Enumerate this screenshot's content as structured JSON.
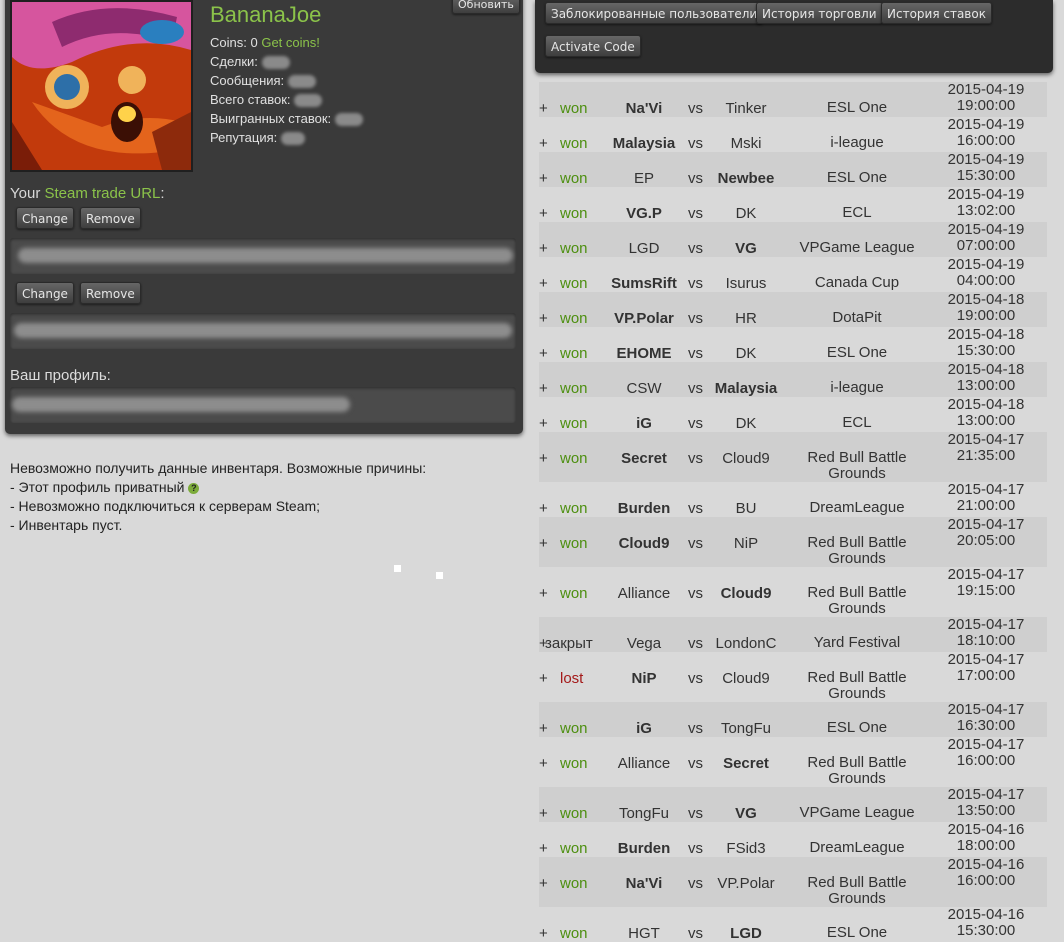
{
  "profile": {
    "username": "BananaJoe",
    "refresh_button": "Обновить",
    "stats": {
      "coins_label": "Coins: 0",
      "get_coins": "Get coins!",
      "deals": "Сделки:",
      "messages": "Сообщения:",
      "total_bets": "Всего ставок:",
      "won_bets": "Выигранных ставок:",
      "reputation": "Репутация:"
    },
    "trade_url": {
      "prefix": "Your ",
      "link": "Steam trade URL",
      "suffix": ":"
    },
    "buttons": {
      "change": "Change",
      "remove": "Remove"
    },
    "profile_label": "Ваш профиль:"
  },
  "notice": {
    "line1": "Невозможно получить данные инвентаря. Возможные причины:",
    "line2": "- Этот профиль приватный",
    "line3": "- Невозможно подключиться к серверам Steam;",
    "line4": "- Инвентарь пуст.",
    "help_glyph": "?"
  },
  "toolbar": {
    "blocked_users": "Заблокированные пользователи",
    "trade_history": "История торговли",
    "bet_history": "История ставок",
    "activate_code": "Activate Code"
  },
  "vs_label": "vs",
  "bets": [
    {
      "plus": "+",
      "result": "won",
      "t1": "Na'Vi",
      "t2": "Tinker",
      "winner": 1,
      "event": [
        "ESL One"
      ],
      "date": "2015-04-19",
      "time": "19:00:00"
    },
    {
      "plus": "+",
      "result": "won",
      "t1": "Malaysia",
      "t2": "Mski",
      "winner": 1,
      "event": [
        "i-league"
      ],
      "date": "2015-04-19",
      "time": "16:00:00"
    },
    {
      "plus": "+",
      "result": "won",
      "t1": "EP",
      "t2": "Newbee",
      "winner": 2,
      "event": [
        "ESL One"
      ],
      "date": "2015-04-19",
      "time": "15:30:00"
    },
    {
      "plus": "+",
      "result": "won",
      "t1": "VG.P",
      "t2": "DK",
      "winner": 1,
      "event": [
        "ECL"
      ],
      "date": "2015-04-19",
      "time": "13:02:00"
    },
    {
      "plus": "+",
      "result": "won",
      "t1": "LGD",
      "t2": "VG",
      "winner": 2,
      "event": [
        "VPGame League"
      ],
      "date": "2015-04-19",
      "time": "07:00:00"
    },
    {
      "plus": "+",
      "result": "won",
      "t1": "SumsRift",
      "t2": "Isurus",
      "winner": 1,
      "event": [
        "Canada Cup"
      ],
      "date": "2015-04-19",
      "time": "04:00:00"
    },
    {
      "plus": "+",
      "result": "won",
      "t1": "VP.Polar",
      "t2": "HR",
      "winner": 1,
      "event": [
        "DotaPit"
      ],
      "date": "2015-04-18",
      "time": "19:00:00"
    },
    {
      "plus": "+",
      "result": "won",
      "t1": "EHOME",
      "t2": "DK",
      "winner": 1,
      "event": [
        "ESL One"
      ],
      "date": "2015-04-18",
      "time": "15:30:00"
    },
    {
      "plus": "+",
      "result": "won",
      "t1": "CSW",
      "t2": "Malaysia",
      "winner": 2,
      "event": [
        "i-league"
      ],
      "date": "2015-04-18",
      "time": "13:00:00"
    },
    {
      "plus": "+",
      "result": "won",
      "t1": "iG",
      "t2": "DK",
      "winner": 1,
      "event": [
        "ECL"
      ],
      "date": "2015-04-18",
      "time": "13:00:00"
    },
    {
      "plus": "+",
      "result": "won",
      "t1": "Secret",
      "t2": "Cloud9",
      "winner": 1,
      "event": [
        "Red Bull Battle",
        "Grounds"
      ],
      "date": "2015-04-17",
      "time": "21:35:00"
    },
    {
      "plus": "+",
      "result": "won",
      "t1": "Burden",
      "t2": "BU",
      "winner": 1,
      "event": [
        "DreamLeague"
      ],
      "date": "2015-04-17",
      "time": "21:00:00"
    },
    {
      "plus": "+",
      "result": "won",
      "t1": "Cloud9",
      "t2": "NiP",
      "winner": 1,
      "event": [
        "Red Bull Battle",
        "Grounds"
      ],
      "date": "2015-04-17",
      "time": "20:05:00"
    },
    {
      "plus": "+",
      "result": "won",
      "t1": "Alliance",
      "t2": "Cloud9",
      "winner": 2,
      "event": [
        "Red Bull Battle",
        "Grounds"
      ],
      "date": "2015-04-17",
      "time": "19:15:00"
    },
    {
      "plus": "+",
      "result": "закрыт",
      "t1": "Vega",
      "t2": "LondonC",
      "winner": 0,
      "event": [
        "Yard Festival"
      ],
      "date": "2015-04-17",
      "time": "18:10:00"
    },
    {
      "plus": "+",
      "result": "lost",
      "t1": "NiP",
      "t2": "Cloud9",
      "winner": 1,
      "event": [
        "Red Bull Battle",
        "Grounds"
      ],
      "date": "2015-04-17",
      "time": "17:00:00"
    },
    {
      "plus": "+",
      "result": "won",
      "t1": "iG",
      "t2": "TongFu",
      "winner": 1,
      "event": [
        "ESL One"
      ],
      "date": "2015-04-17",
      "time": "16:30:00"
    },
    {
      "plus": "+",
      "result": "won",
      "t1": "Alliance",
      "t2": "Secret",
      "winner": 2,
      "event": [
        "Red Bull Battle",
        "Grounds"
      ],
      "date": "2015-04-17",
      "time": "16:00:00"
    },
    {
      "plus": "+",
      "result": "won",
      "t1": "TongFu",
      "t2": "VG",
      "winner": 2,
      "event": [
        "VPGame League"
      ],
      "date": "2015-04-17",
      "time": "13:50:00"
    },
    {
      "plus": "+",
      "result": "won",
      "t1": "Burden",
      "t2": "FSid3",
      "winner": 1,
      "event": [
        "DreamLeague"
      ],
      "date": "2015-04-16",
      "time": "18:00:00"
    },
    {
      "plus": "+",
      "result": "won",
      "t1": "Na'Vi",
      "t2": "VP.Polar",
      "winner": 1,
      "event": [
        "Red Bull Battle",
        "Grounds"
      ],
      "date": "2015-04-16",
      "time": "16:00:00"
    },
    {
      "plus": "+",
      "result": "won",
      "t1": "HGT",
      "t2": "LGD",
      "winner": 2,
      "event": [
        "ESL One"
      ],
      "date": "2015-04-16",
      "time": "15:30:00"
    }
  ]
}
